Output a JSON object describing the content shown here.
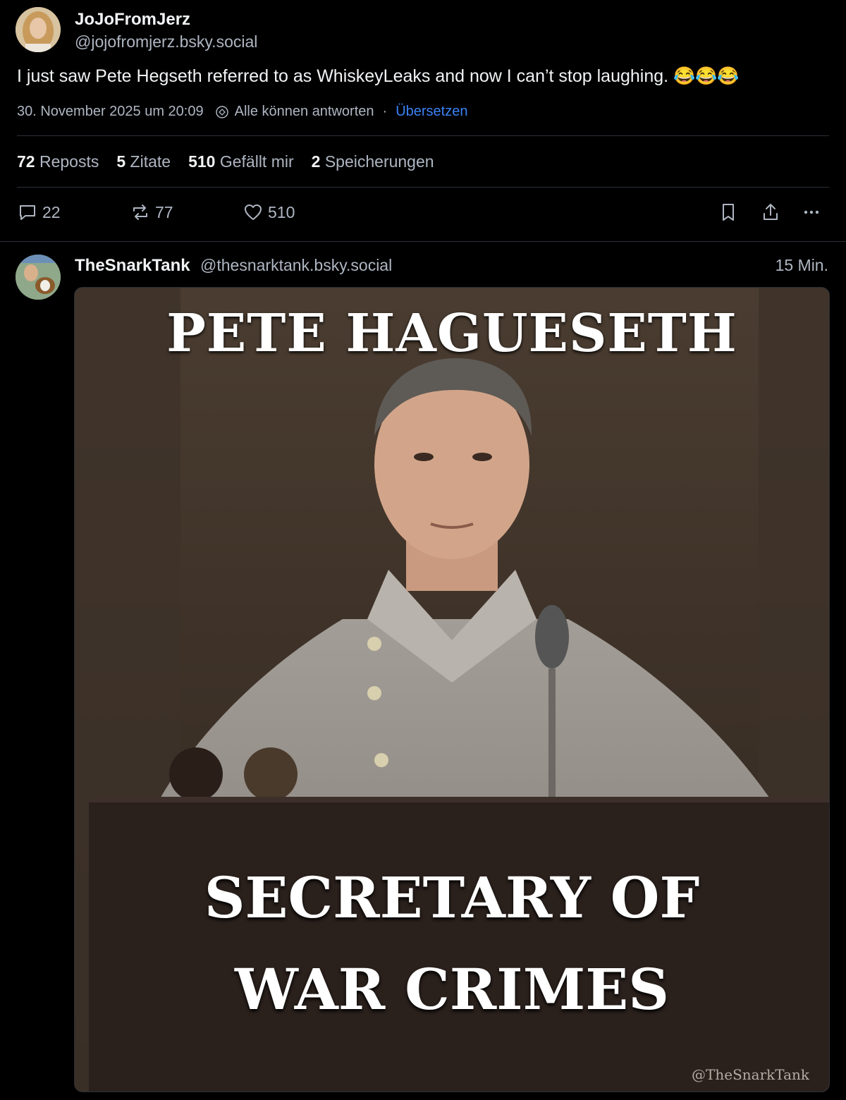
{
  "post": {
    "author_name": "JoJoFromJerz",
    "author_handle": "@jojofromjerz.bsky.social",
    "text": "I just saw Pete Hegseth referred to as WhiskeyLeaks and now I can’t stop laughing. 😂😂😂",
    "timestamp": "30. November 2025 um 20:09",
    "reply_setting": "Alle können antworten",
    "separator": "·",
    "translate": "Übersetzen",
    "stats": [
      {
        "count": "72",
        "label": "Reposts"
      },
      {
        "count": "5",
        "label": "Zitate"
      },
      {
        "count": "510",
        "label": "Gefällt mir"
      },
      {
        "count": "2",
        "label": "Speicherungen"
      }
    ],
    "actions": {
      "replies": "22",
      "reposts": "77",
      "likes": "510"
    }
  },
  "reply": {
    "author_name": "TheSnarkTank",
    "author_handle": "@thesnarktank.bsky.social",
    "time": "15 Min.",
    "image": {
      "title": "PETE HAGUESETH",
      "caption_line1": "SECRETARY OF",
      "caption_line2": "WAR CRIMES",
      "watermark": "@TheSnarkTank"
    }
  },
  "colors": {
    "background": "#000000",
    "text": "#f1f3f5",
    "muted": "#aeb6c2",
    "link": "#3b82f6",
    "divider": "#2a2f36"
  }
}
